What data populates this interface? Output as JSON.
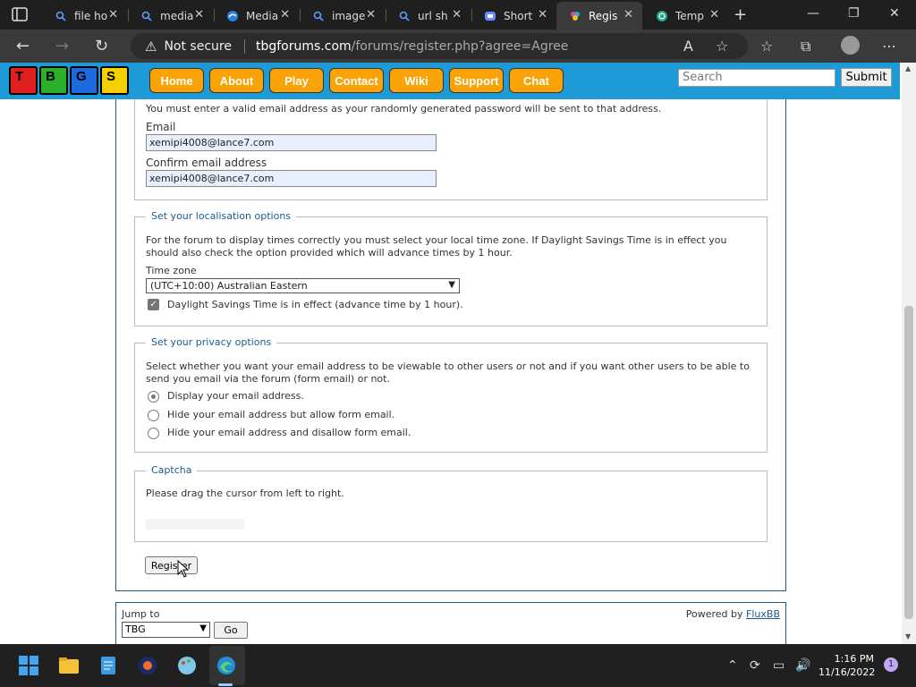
{
  "browser": {
    "tabs": [
      {
        "title": "file ho",
        "icon": "search-icon"
      },
      {
        "title": "media",
        "icon": "search-icon"
      },
      {
        "title": "Media",
        "icon": "edge-icon"
      },
      {
        "title": "image",
        "icon": "search-icon"
      },
      {
        "title": "url sh",
        "icon": "search-icon"
      },
      {
        "title": "Short",
        "icon": "chat-icon"
      },
      {
        "title": "Regis",
        "icon": "site-icon"
      },
      {
        "title": "Temp",
        "icon": "mail-icon"
      }
    ],
    "active_tab": 6,
    "security": "Not secure",
    "url_domain": "tbgforums.com",
    "url_path": "/forums/register.php?agree=Agree"
  },
  "site": {
    "logo_letters": [
      "T",
      "B",
      "G",
      "S"
    ],
    "logo_colors": [
      "#e02020",
      "#2bb02b",
      "#1e6be0",
      "#f5d000"
    ],
    "menu": [
      "Home",
      "About",
      "Play",
      "Contact",
      "Wiki",
      "Support",
      "Chat"
    ],
    "search_placeholder": "Search",
    "submit_label": "Submit"
  },
  "form": {
    "email_note": "You must enter a valid email address as your randomly generated password will be sent to that address.",
    "email_label": "Email",
    "email_value": "xemipi4008@lance7.com",
    "confirm_label": "Confirm email address",
    "confirm_value": "xemipi4008@lance7.com",
    "localisation": {
      "legend": "Set your localisation options",
      "note": "For the forum to display times correctly you must select your local time zone. If Daylight Savings Time is in effect you should also check the option provided which will advance times by 1 hour.",
      "tz_label": "Time zone",
      "tz_value": "(UTC+10:00) Australian Eastern",
      "dst_label": "Daylight Savings Time is in effect (advance time by 1 hour)."
    },
    "privacy": {
      "legend": "Set your privacy options",
      "note": "Select whether you want your email address to be viewable to other users or not and if you want other users to be able to send you email via the forum (form email) or not.",
      "options": [
        "Display your email address.",
        "Hide your email address but allow form email.",
        "Hide your email address and disallow form email."
      ],
      "selected": 0
    },
    "captcha": {
      "legend": "Captcha",
      "note": "Please drag the cursor from left to right."
    },
    "register_label": "Register"
  },
  "footer": {
    "jump_label": "Jump to",
    "jump_value": "TBG",
    "go_label": "Go",
    "powered_by": "Powered by",
    "powered_link": "FluxBB"
  },
  "taskbar": {
    "time": "1:16 PM",
    "date": "11/16/2022",
    "notifications": "1"
  }
}
